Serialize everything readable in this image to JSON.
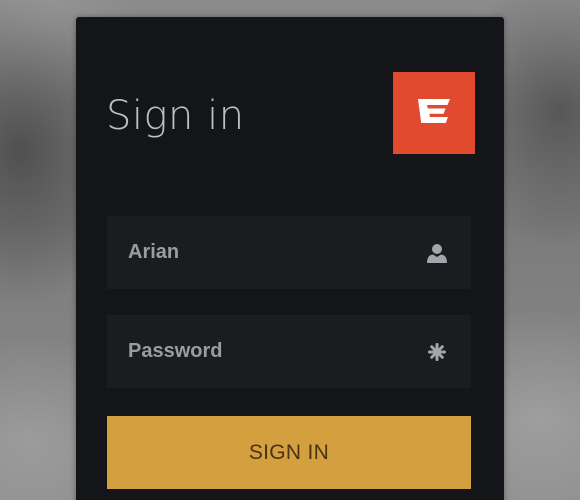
{
  "login": {
    "title": "Sign in",
    "username_value": "Arian",
    "password_placeholder": "Password",
    "submit_label": "SIGN IN"
  },
  "icons": {
    "logo": "html5-shield-logo-icon",
    "username": "user-icon",
    "password": "asterisk-icon"
  },
  "colors": {
    "card_background": "#141518",
    "field_background": "#1b1c20",
    "logo_background": "#e14a2f",
    "button_background": "#d49f3f",
    "button_text": "#4a3414",
    "title_text": "#bdbfc4",
    "field_text": "#9a9ca1"
  }
}
